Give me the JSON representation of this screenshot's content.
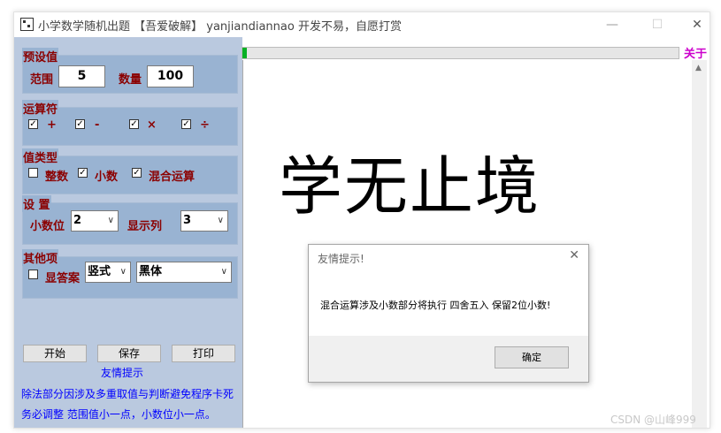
{
  "window": {
    "title": "小学数学随机出题 【吾爱破解】 yanjiandiannao 开发不易，自愿打赏",
    "minimize_glyph": "—",
    "maximize_glyph": "☐",
    "close_glyph": "✕"
  },
  "presets": {
    "title": "预设值",
    "range_label": "范围",
    "range_value": "5",
    "count_label": "数量",
    "count_value": "100"
  },
  "operators": {
    "title": "运算符",
    "items": [
      {
        "symbol": "+",
        "checked": true
      },
      {
        "symbol": "-",
        "checked": true
      },
      {
        "symbol": "×",
        "checked": true
      },
      {
        "symbol": "÷",
        "checked": true
      }
    ]
  },
  "value_type": {
    "title": "值类型",
    "integer_label": "整数",
    "integer_checked": false,
    "decimal_label": "小数",
    "decimal_checked": true,
    "mixed_label": "混合运算",
    "mixed_checked": true
  },
  "settings": {
    "title": "设 置",
    "decimals_label": "小数位",
    "decimals_value": "2",
    "columns_label": "显示列",
    "columns_value": "3"
  },
  "other": {
    "title": "其他项",
    "show_answer_label": "显答案",
    "show_answer_checked": false,
    "format_value": "竖式",
    "font_value": "黑体"
  },
  "buttons": {
    "start": "开始",
    "save": "保存",
    "print": "打印"
  },
  "tips": {
    "heading": "友情提示",
    "line1": "除法部分因涉及多重取值与判断避免程序卡死",
    "line2": "务必调整 范围值小一点，小数位小一点。"
  },
  "about_label": "关于",
  "progress": {
    "fraction": 0.01
  },
  "canvas": {
    "headline": "学无止境"
  },
  "dialog": {
    "title": "友情提示!",
    "message": "混合运算涉及小数部分将执行 四舍五入 保留2位小数!",
    "ok_label": "确定"
  },
  "watermark": "CSDN @山峰999"
}
